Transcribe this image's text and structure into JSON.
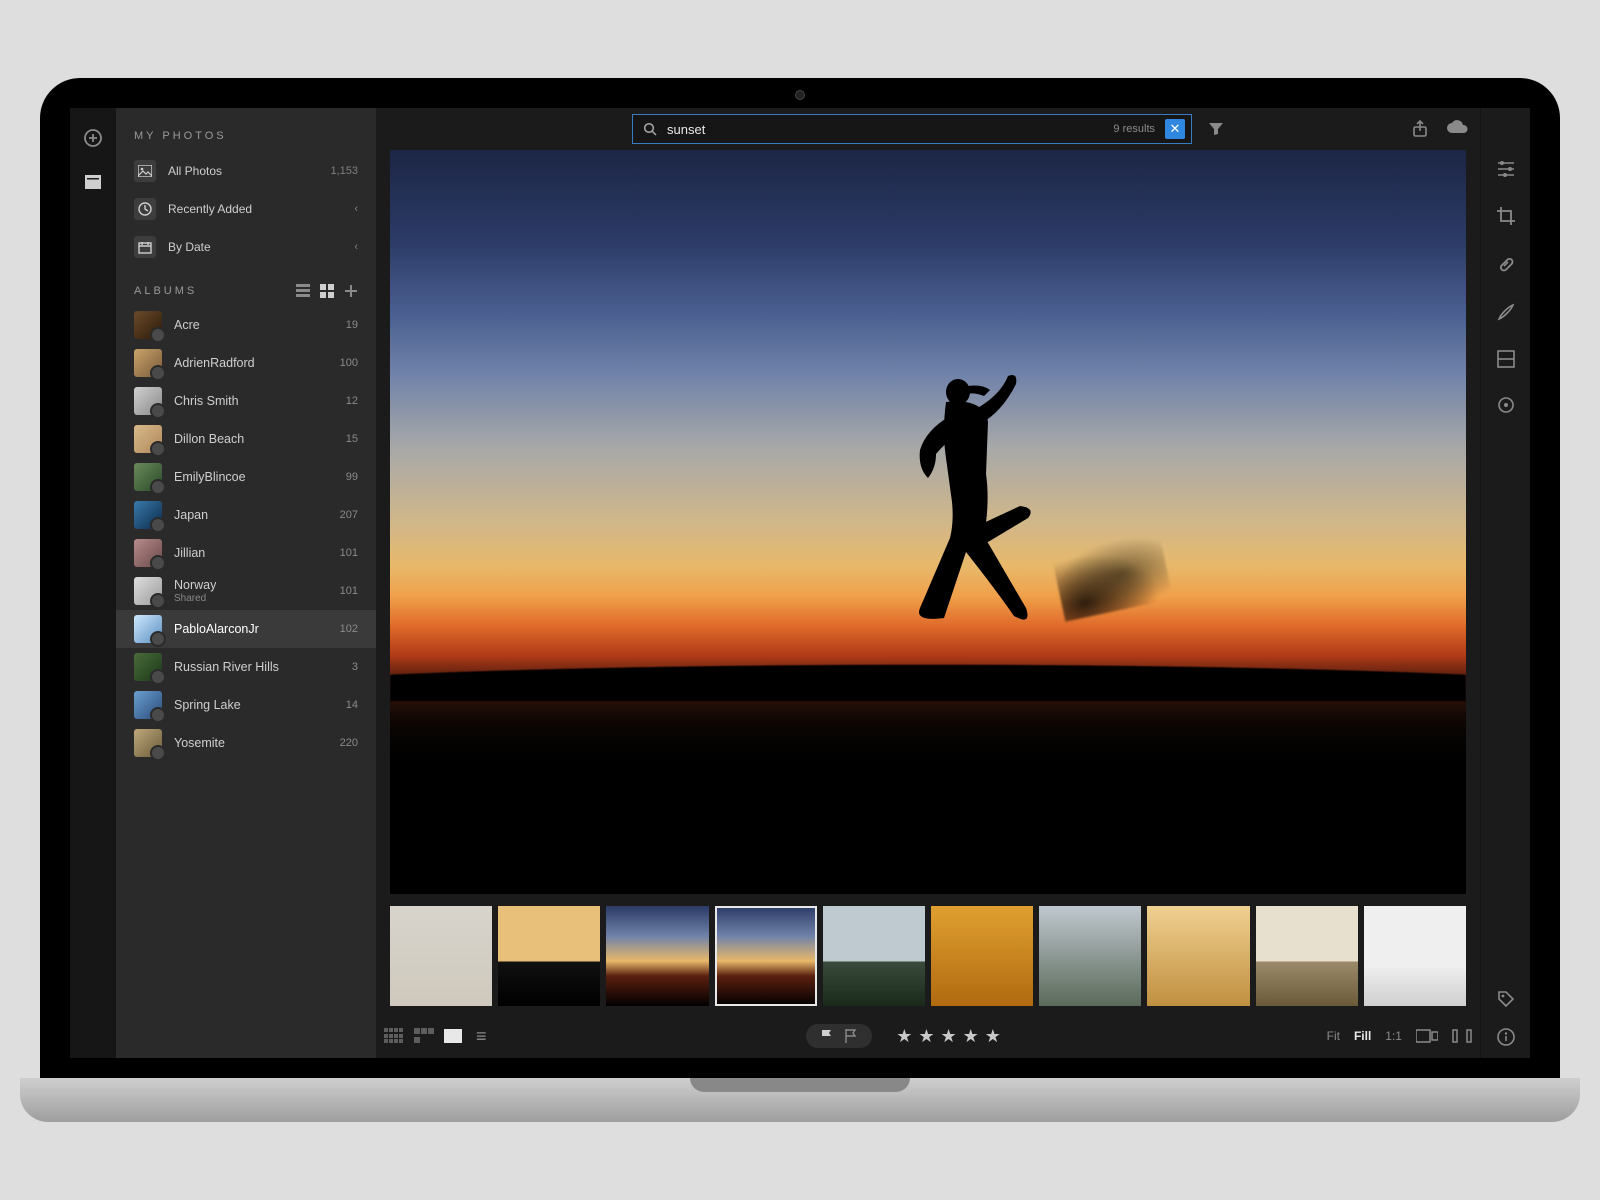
{
  "search": {
    "value": "sunset",
    "results_label": "9 results"
  },
  "sidebar": {
    "my_photos_title": "MY PHOTOS",
    "nav": [
      {
        "label": "All Photos",
        "meta": "1,153",
        "icon": "image-icon"
      },
      {
        "label": "Recently Added",
        "meta": "‹",
        "icon": "clock-icon"
      },
      {
        "label": "By Date",
        "meta": "‹",
        "icon": "calendar-icon"
      }
    ],
    "albums_title": "ALBUMS",
    "albums": [
      {
        "name": "Acre",
        "count": "19",
        "thumb": "t0"
      },
      {
        "name": "AdrienRadford",
        "count": "100",
        "thumb": "t1"
      },
      {
        "name": "Chris Smith",
        "count": "12",
        "thumb": "t2"
      },
      {
        "name": "Dillon Beach",
        "count": "15",
        "thumb": "t3"
      },
      {
        "name": "EmilyBlincoe",
        "count": "99",
        "thumb": "t4"
      },
      {
        "name": "Japan",
        "count": "207",
        "thumb": "t5"
      },
      {
        "name": "Jillian",
        "count": "101",
        "thumb": "t6"
      },
      {
        "name": "Norway",
        "sub": "Shared",
        "count": "101",
        "thumb": "t7"
      },
      {
        "name": "PabloAlarconJr",
        "count": "102",
        "thumb": "t8",
        "selected": true
      },
      {
        "name": "Russian River Hills",
        "count": "3",
        "thumb": "t9"
      },
      {
        "name": "Spring Lake",
        "count": "14",
        "thumb": "t10"
      },
      {
        "name": "Yosemite",
        "count": "220",
        "thumb": "t11"
      }
    ]
  },
  "bottombar": {
    "sort_icon": "≡",
    "stars": "★★★★★",
    "fit": "Fit",
    "fill": "Fill",
    "one_to_one": "1:1"
  },
  "filmstrip": {
    "count": 10,
    "selected_index": 3
  }
}
